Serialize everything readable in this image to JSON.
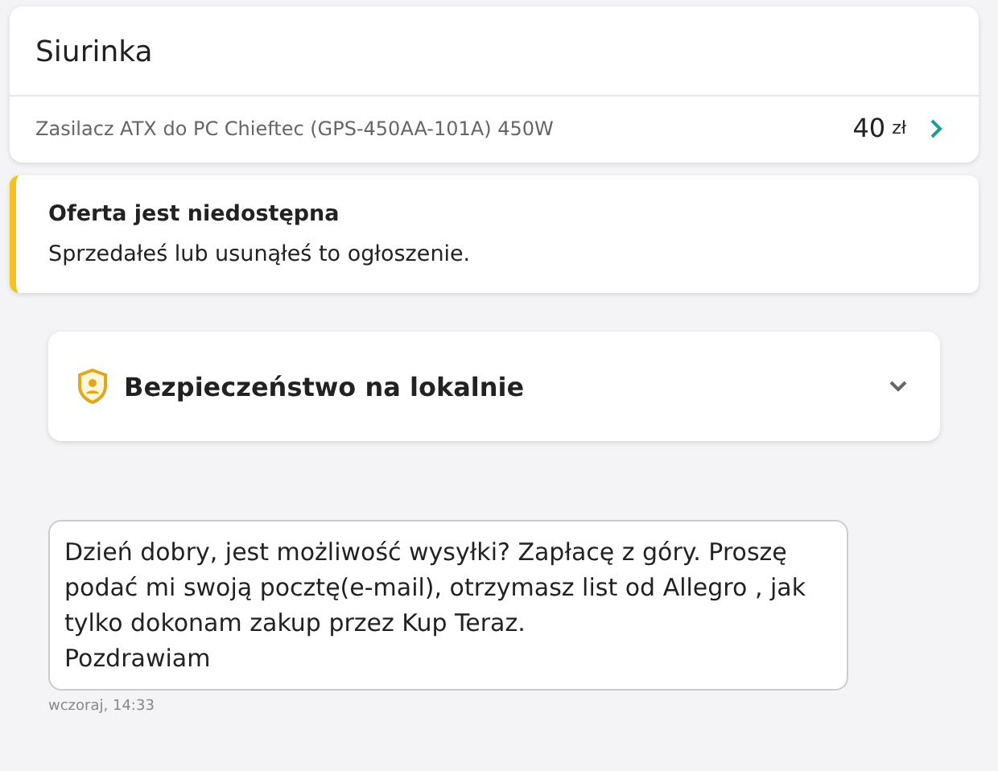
{
  "conversation": {
    "title": "Siurinka",
    "offer": {
      "name": "Zasilacz ATX do PC Chieftec (GPS-450AA-101A) 450W",
      "price": "40",
      "currency": "zł"
    }
  },
  "alert": {
    "title": "Oferta jest niedostępna",
    "text": "Sprzedałeś lub usunąłeś to ogłoszenie."
  },
  "safety": {
    "title": "Bezpieczeństwo na lokalnie",
    "expanded": false
  },
  "messages": [
    {
      "text": "Dzień dobry, jest możliwość wysyłki? Zapłacę z góry. Proszę podać mi swoją pocztę(e-mail), otrzymasz list od Allegro , jak tylko dokonam zakup przez Kup Teraz.\nPozdrawiam",
      "time": "wczoraj, 14:33"
    }
  ]
}
